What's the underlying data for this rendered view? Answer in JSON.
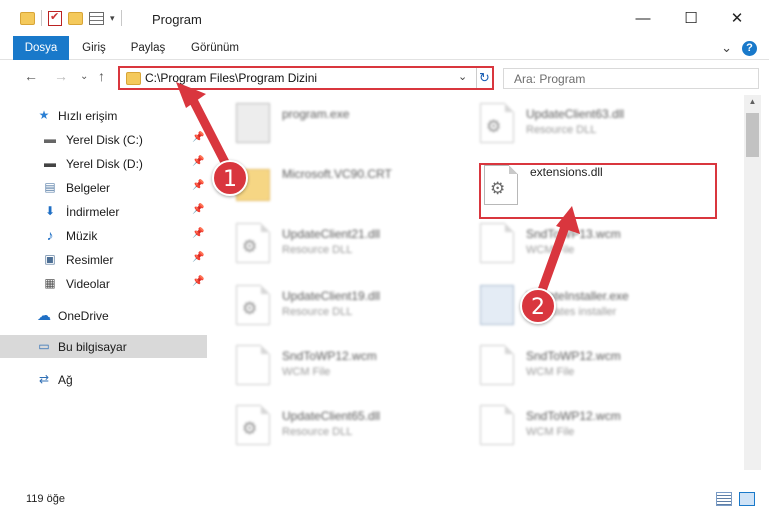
{
  "window": {
    "title": "Program",
    "minimize": "—",
    "maximize": "☐",
    "close": "✕"
  },
  "ribbon": {
    "tabs": [
      "Dosya",
      "Giriş",
      "Paylaş",
      "Görünüm"
    ],
    "expand_glyph": "⌄",
    "help_glyph": "?"
  },
  "navigation": {
    "back": "←",
    "forward": "→",
    "recent": "⌄",
    "up": "↑",
    "address_path": "C:\\Program Files\\Program Dizini",
    "address_dropdown": "⌄",
    "refresh": "↻",
    "search_placeholder": "Ara: Program"
  },
  "sidebar": {
    "items": [
      {
        "label": "Hızlı erişim",
        "icon": "star-icon",
        "glyph": "★",
        "pinned": false
      },
      {
        "label": "Yerel Disk (C:)",
        "icon": "drive-icon",
        "glyph": "▬",
        "pinned": true
      },
      {
        "label": "Yerel Disk (D:)",
        "icon": "drive-icon",
        "glyph": "▬",
        "pinned": true
      },
      {
        "label": "Belgeler",
        "icon": "documents-icon",
        "glyph": "▤",
        "pinned": true
      },
      {
        "label": "İndirmeler",
        "icon": "download-icon",
        "glyph": "⬇",
        "pinned": true
      },
      {
        "label": "Müzik",
        "icon": "music-icon",
        "glyph": "♪",
        "pinned": true
      },
      {
        "label": "Resimler",
        "icon": "pictures-icon",
        "glyph": "▣",
        "pinned": true
      },
      {
        "label": "Videolar",
        "icon": "video-icon",
        "glyph": "▦",
        "pinned": true
      },
      {
        "label": "OneDrive",
        "icon": "cloud-icon",
        "glyph": "☁",
        "pinned": false
      },
      {
        "label": "Bu bilgisayar",
        "icon": "computer-icon",
        "glyph": "▭",
        "pinned": false,
        "selected": true
      },
      {
        "label": "Ağ",
        "icon": "network-icon",
        "glyph": "⇄",
        "pinned": false
      }
    ],
    "pin_glyph": "📌"
  },
  "files": [
    {
      "name": "program.exe",
      "desc": "",
      "icon": "exe-icon"
    },
    {
      "name": "UpdateClient63.dll",
      "desc": "Resource DLL",
      "icon": "dll-icon"
    },
    {
      "name": "Microsoft.VC90.CRT",
      "desc": "",
      "icon": "folder-icon"
    },
    {
      "name": "extensions.dll",
      "desc": "",
      "icon": "dll-icon"
    },
    {
      "name": "UpdateClient21.dll",
      "desc": "Resource DLL",
      "icon": "dll-icon"
    },
    {
      "name": "SndToWP13.wcm",
      "desc": "WCM File",
      "icon": "file-icon"
    },
    {
      "name": "UpdateClient19.dll",
      "desc": "Resource DLL",
      "icon": "dll-icon"
    },
    {
      "name": "UpdateInstaller.exe",
      "desc": "Y updates installer",
      "icon": "installer-icon"
    },
    {
      "name": "SndToWP12.wcm",
      "desc": "WCM File",
      "icon": "file-icon"
    },
    {
      "name": "SndToWP12.wcm",
      "desc": "WCM File",
      "icon": "file-icon"
    },
    {
      "name": "UpdateClient65.dll",
      "desc": "Resource DLL",
      "icon": "dll-icon"
    },
    {
      "name": "SndToWP12.wcm",
      "desc": "WCM File",
      "icon": "file-icon"
    }
  ],
  "annotations": {
    "step1": "1",
    "step2": "2",
    "accent": "#d9363e"
  },
  "status": {
    "count": "119 öğe"
  },
  "colors": {
    "ribbon_active": "#1979ca",
    "selection": "#d9d9d9"
  }
}
